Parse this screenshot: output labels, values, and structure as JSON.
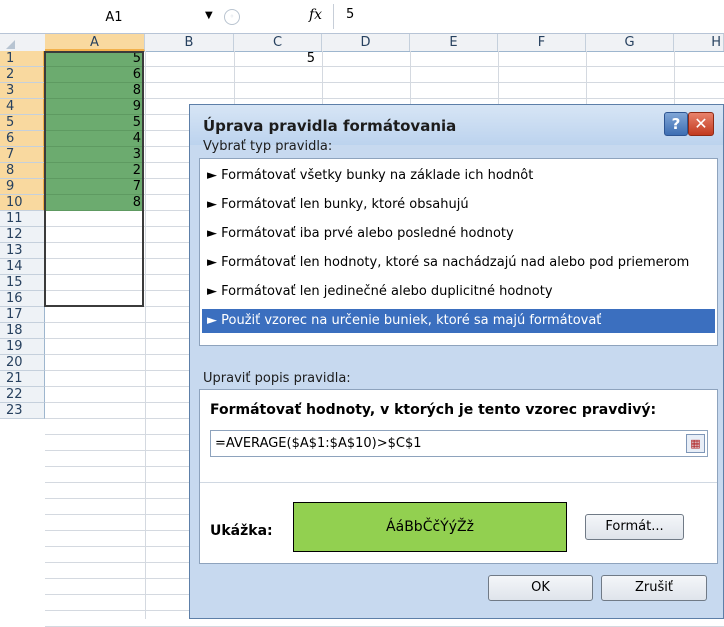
{
  "formula_bar": {
    "name_box": "A1",
    "fx_label": "fx",
    "value": "5"
  },
  "grid": {
    "columns": [
      "A",
      "B",
      "C",
      "D",
      "E",
      "F",
      "G",
      "H"
    ],
    "rows": [
      "1",
      "2",
      "3",
      "4",
      "5",
      "6",
      "7",
      "8",
      "9",
      "10",
      "11",
      "12",
      "13",
      "14",
      "15",
      "16",
      "17",
      "18",
      "19",
      "20",
      "21",
      "22",
      "23"
    ],
    "column_a_values": [
      "5",
      "6",
      "8",
      "9",
      "5",
      "4",
      "3",
      "2",
      "7",
      "8"
    ],
    "c1_value": "5",
    "highlight_color": "#6cab6f"
  },
  "dialog": {
    "title": "Úprava pravidla formátovania",
    "help_label": "?",
    "close_label": "✕",
    "rule_type_label": "Vybrať typ pravidla:",
    "rule_types": [
      "► Formátovať všetky bunky na základe ich hodnôt",
      "► Formátovať len bunky, ktoré obsahujú",
      "► Formátovať iba prvé alebo posledné hodnoty",
      "► Formátovať len hodnoty, ktoré sa nachádzajú nad alebo pod priemerom",
      "► Formátovať len jedinečné alebo duplicitné hodnoty",
      "► Použiť vzorec na určenie buniek, ktoré sa majú formátovať"
    ],
    "selected_rule_index": 5,
    "edit_label": "Upraviť popis pravidla:",
    "edit_title": "Formátovať hodnoty, v ktorých je tento vzorec pravdivý:",
    "formula": "=AVERAGE($A$1:$A$10)>$C$1",
    "preview_label": "Ukážka:",
    "preview_text": "ÁáBbČčÝýŽž",
    "preview_color": "#92d050",
    "format_button": "Formát...",
    "ok_button": "OK",
    "cancel_button": "Zrušiť"
  }
}
